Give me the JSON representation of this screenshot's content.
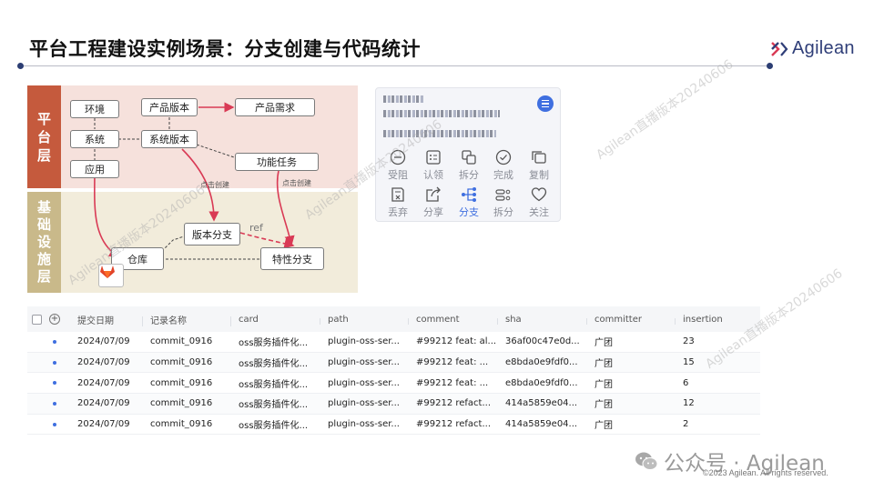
{
  "header": {
    "title": "平台工程建设实例场景：分支创建与代码统计",
    "logo_text": "Agilean",
    "accent_color": "#2c3e73"
  },
  "diagram": {
    "layer_top_label": [
      "平",
      "台",
      "层"
    ],
    "layer_bottom_label": [
      "基",
      "础",
      "设",
      "施",
      "层"
    ],
    "nodes": {
      "env": "环境",
      "system": "系统",
      "app": "应用",
      "product_version": "产品版本",
      "product_requirement": "产品需求",
      "system_version": "系统版本",
      "feature_task": "功能任务",
      "version_branch": "版本分支",
      "repo": "仓库",
      "feature_branch": "特性分支"
    },
    "edge_labels": {
      "click_create_left": "点击创建",
      "click_create_right": "点击创建",
      "ref": "ref"
    },
    "colors": {
      "arrow": "#d93a55",
      "top_band": "#f6e1dc",
      "bottom_band": "#f2ecdb"
    },
    "repo_icon": "gitlab-icon"
  },
  "card": {
    "menu_icon": "menu-icon",
    "actions": [
      {
        "label": "受阻",
        "icon": "minus-circle-icon"
      },
      {
        "label": "认领",
        "icon": "claim-icon"
      },
      {
        "label": "拆分",
        "icon": "split-icon"
      },
      {
        "label": "完成",
        "icon": "check-circle-icon"
      },
      {
        "label": "复制",
        "icon": "copy-icon"
      },
      {
        "label": "丢弃",
        "icon": "discard-icon"
      },
      {
        "label": "分享",
        "icon": "share-icon"
      },
      {
        "label": "分支",
        "icon": "branch-icon",
        "active": true
      },
      {
        "label": "拆分",
        "icon": "split-alt-icon"
      },
      {
        "label": "关注",
        "icon": "heart-icon"
      }
    ]
  },
  "table": {
    "columns": [
      "提交日期",
      "记录名称",
      "card",
      "path",
      "comment",
      "sha",
      "committer",
      "insertion"
    ],
    "rows": [
      [
        "2024/07/09",
        "commit_0916",
        "oss服务插件化...",
        "plugin-oss-ser...",
        "#99212 feat: al...",
        "36af00c47e0d...",
        "广团",
        "23"
      ],
      [
        "2024/07/09",
        "commit_0916",
        "oss服务插件化...",
        "plugin-oss-ser...",
        "#99212 feat: ...",
        "e8bda0e9fdf0...",
        "广团",
        "15"
      ],
      [
        "2024/07/09",
        "commit_0916",
        "oss服务插件化...",
        "plugin-oss-ser...",
        "#99212 feat: ...",
        "e8bda0e9fdf0...",
        "广团",
        "6"
      ],
      [
        "2024/07/09",
        "commit_0916",
        "oss服务插件化...",
        "plugin-oss-ser...",
        "#99212 refact...",
        "414a5859e04...",
        "广团",
        "12"
      ],
      [
        "2024/07/09",
        "commit_0916",
        "oss服务插件化...",
        "plugin-oss-ser...",
        "#99212 refact...",
        "414a5859e04...",
        "广团",
        "2"
      ]
    ]
  },
  "watermark": "Agilean直播版本20240606",
  "footer": {
    "wechat_label": "公众号 · Agilean",
    "copyright": "©2023 Agilean. All rights reserved."
  }
}
